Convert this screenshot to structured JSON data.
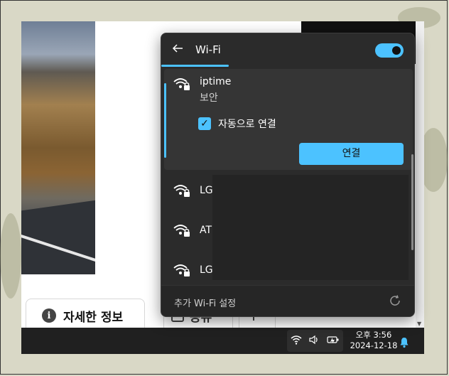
{
  "flyout": {
    "title": "Wi-Fi",
    "toggle_on": true,
    "selected_network": {
      "name": "iptime",
      "security": "보안",
      "auto_connect_label": "자동으로 연결",
      "auto_connect_checked": true,
      "connect_label": "연결"
    },
    "networks": [
      {
        "name": "LG"
      },
      {
        "name": "AT"
      },
      {
        "name": "LG"
      }
    ],
    "more_settings_label": "추가 Wi-Fi 설정"
  },
  "page": {
    "detail_button_label": "자세한 정보",
    "share_button_label": "공유"
  },
  "taskbar": {
    "time": "오후 3:56",
    "date": "2024-12-18"
  },
  "colors": {
    "accent": "#4cc2ff",
    "flyout_bg": "#2b2b2b",
    "taskbar_bg": "#202020"
  }
}
